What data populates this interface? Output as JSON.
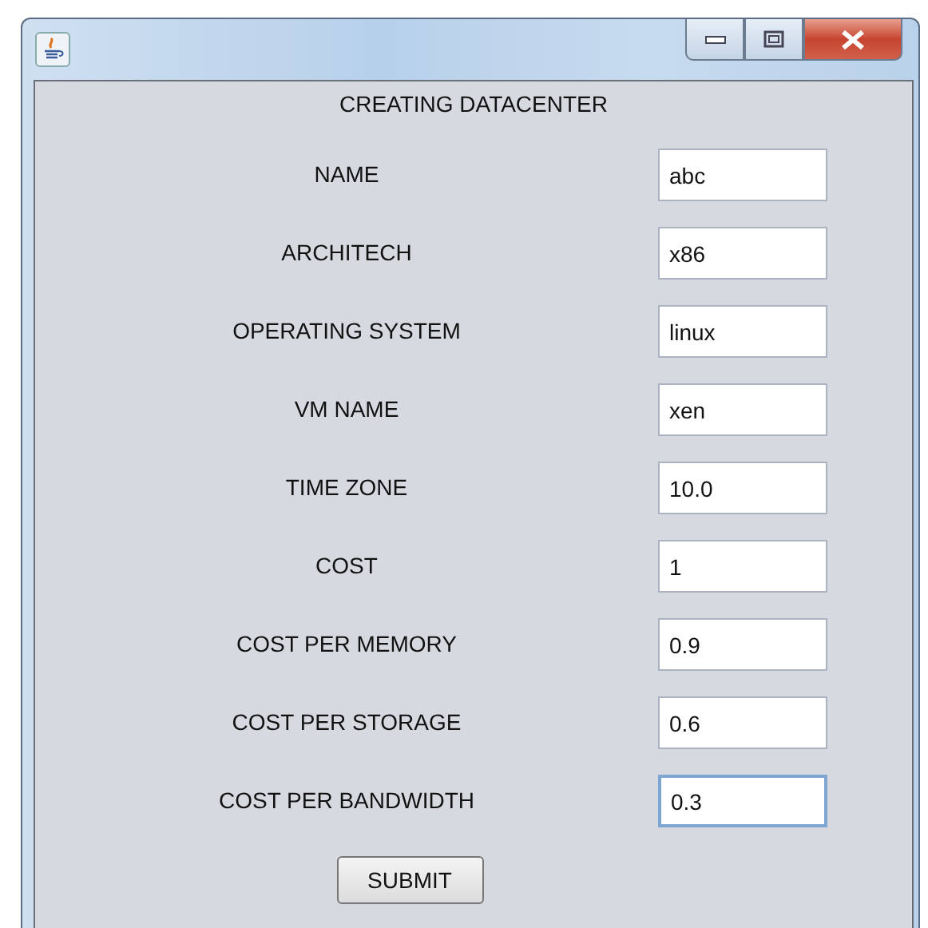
{
  "window": {
    "title_buttons": [
      {
        "kind": "minimize"
      },
      {
        "kind": "maximize"
      },
      {
        "kind": "close"
      }
    ]
  },
  "heading": "CREATING DATACENTER",
  "fields": [
    {
      "label": "NAME",
      "value": "abc",
      "focused": false
    },
    {
      "label": "ARCHITECH",
      "value": "x86",
      "focused": false
    },
    {
      "label": "OPERATING SYSTEM",
      "value": "linux",
      "focused": false
    },
    {
      "label": "VM NAME",
      "value": "xen",
      "focused": false
    },
    {
      "label": "TIME ZONE",
      "value": "10.0",
      "focused": false
    },
    {
      "label": "COST",
      "value": "1",
      "focused": false
    },
    {
      "label": "COST PER MEMORY",
      "value": "0.9",
      "focused": false
    },
    {
      "label": "COST PER STORAGE",
      "value": "0.6",
      "focused": false
    },
    {
      "label": "COST PER BANDWIDTH",
      "value": "0.3",
      "focused": true
    }
  ],
  "submit": "SUBMIT"
}
